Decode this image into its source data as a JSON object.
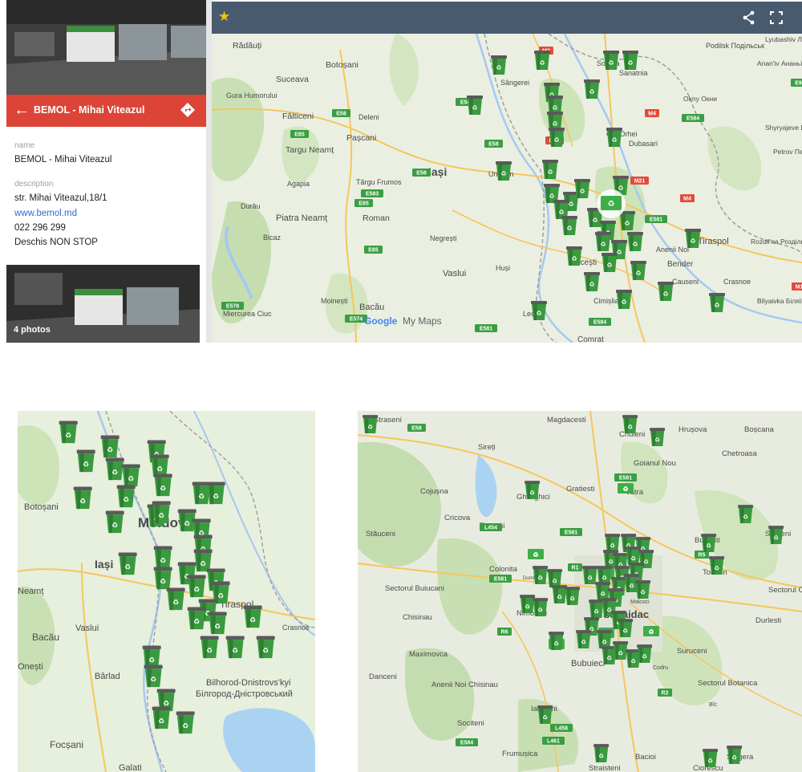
{
  "panel": {
    "title": "BEMOL - Mihai Viteazul",
    "back_icon": "arrow-left-icon",
    "directions_icon": "directions-icon",
    "name_label": "name",
    "name_value": "BEMOL - Mihai Viteazul",
    "description_label": "description",
    "address": "str. Mihai Viteazul,18/1",
    "website": "www.bemol.md",
    "phone": "022 296 299",
    "hours": "Deschis NON STOP",
    "photos_count": "4 photos",
    "accent": "#db4437"
  },
  "map1": {
    "toolbar_color": "#485b6e",
    "watermark_google": "Google",
    "watermark_mymaps": "My Maps",
    "places": [
      "Rădăuți",
      "Botoșani",
      "Suceava",
      "Gura Humorului",
      "Fălticeni",
      "Deleni",
      "Pașcani",
      "Targu Neamț",
      "Târgu Frumos",
      "Iași",
      "Agapia",
      "Durău",
      "Piatra Neamț",
      "Roman",
      "Negrești",
      "Bicaz",
      "Vaslui",
      "Huși",
      "Bacău",
      "Moinești",
      "Miercurea Ciuc",
      "Sângerei",
      "Soroca",
      "Sanatnia",
      "Podilsk Подільськ",
      "Anan'iv Ананьїв",
      "Lyubashiv Любашів",
      "Okny Окни",
      "Shyryajeve Ширяєве",
      "Petrov Петров",
      "Dubasari",
      "Old Orhei",
      "Hîncești",
      "Anenii Noi",
      "Bender",
      "Tiraspol",
      "Rozdil'na Роздільна",
      "Causeni",
      "Crasnoe",
      "Bilyaivka Біляївка",
      "Cimișlia",
      "Comrat",
      "Leova",
      "Unghen"
    ],
    "road_labels": [
      "E58",
      "E85",
      "E583",
      "E581",
      "E584",
      "E574",
      "E578",
      "M2",
      "M14",
      "M4",
      "M21",
      "M3",
      "M16",
      "E95"
    ],
    "icon": "recycle-bin-marker-icon"
  },
  "map2": {
    "places": [
      "Botoșani",
      "Moldova",
      "Iași",
      "Neamț",
      "Vaslui",
      "Bacău",
      "Onești",
      "Bârlad",
      "Focșani",
      "Galati",
      "Crasnoe",
      "Bilhorod-Dnistrovs'kyi",
      "Білгород-Дністровський",
      "Tiraspol"
    ],
    "icon": "recycle-bin-marker-icon"
  },
  "map3": {
    "places": [
      "Straseni",
      "Magdacesti",
      "Sireți",
      "Criuleni",
      "Hrușova",
      "Boșcana",
      "Goianul Nou",
      "Chetroasa",
      "Gratiesti",
      "Cojușna",
      "Ghidighici",
      "Cricova",
      "Trușeni",
      "Vatra",
      "Stăuceni",
      "Scoreni",
      "Budesti",
      "Tohatin",
      "Colonita",
      "Dumbrava",
      "Sectorul Buiucani",
      "Malcoci",
      "Sectorul Ciocana",
      "Sagaidac",
      "Chisinau",
      "Nimoreni",
      "Durlesti",
      "Maximovca",
      "Suruceni",
      "Bubuieci",
      "Codru",
      "Sectorul Botanica",
      "Bîc",
      "Anenii Noi Chisinau",
      "Danceni",
      "Ialoveni",
      "Sociteni",
      "Bacioi",
      "Straisteni",
      "Sîngera",
      "Frumușica",
      "Ciorescu"
    ],
    "road_labels": [
      "E58",
      "E581",
      "L454",
      "R1",
      "E581",
      "R5",
      "R6",
      "R2",
      "L458",
      "L461",
      "E584"
    ],
    "icon": "recycle-bin-marker-icon"
  }
}
